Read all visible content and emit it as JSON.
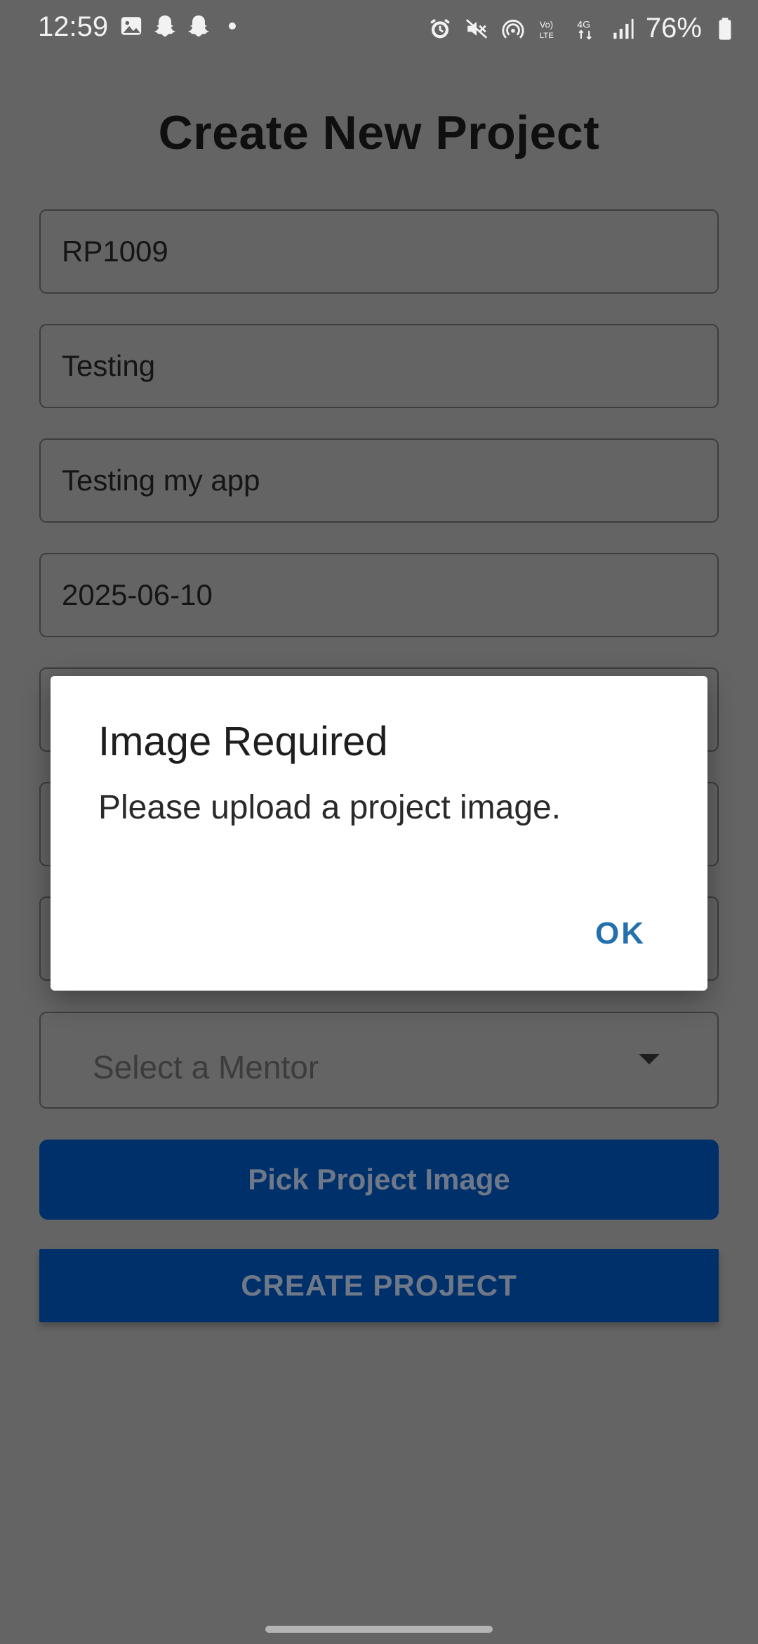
{
  "status_bar": {
    "time": "12:59",
    "battery": "76%",
    "icons_left": [
      "gallery-icon",
      "snapchat-icon",
      "snapchat-icon"
    ],
    "icons_right": [
      "alarm-icon",
      "mute-icon",
      "hotspot-icon",
      "volte-icon",
      "4g-icon",
      "signal-icon",
      "battery-icon"
    ]
  },
  "page": {
    "title": "Create New Project"
  },
  "form": {
    "fields": [
      {
        "value": "RP1009"
      },
      {
        "value": "Testing"
      },
      {
        "value": "Testing my app"
      },
      {
        "value": "2025-06-10"
      },
      {
        "value": ""
      },
      {
        "value": ""
      },
      {
        "value": ""
      }
    ],
    "mentor_select": {
      "placeholder": "Select a Mentor"
    },
    "pick_image_label": "Pick Project Image",
    "create_label": "CREATE PROJECT"
  },
  "dialog": {
    "title": "Image Required",
    "message": "Please upload a project image.",
    "ok_label": "OK"
  },
  "colors": {
    "scrim_background": "#646464",
    "button": "#003069",
    "dialog_accent": "#2470ad"
  }
}
